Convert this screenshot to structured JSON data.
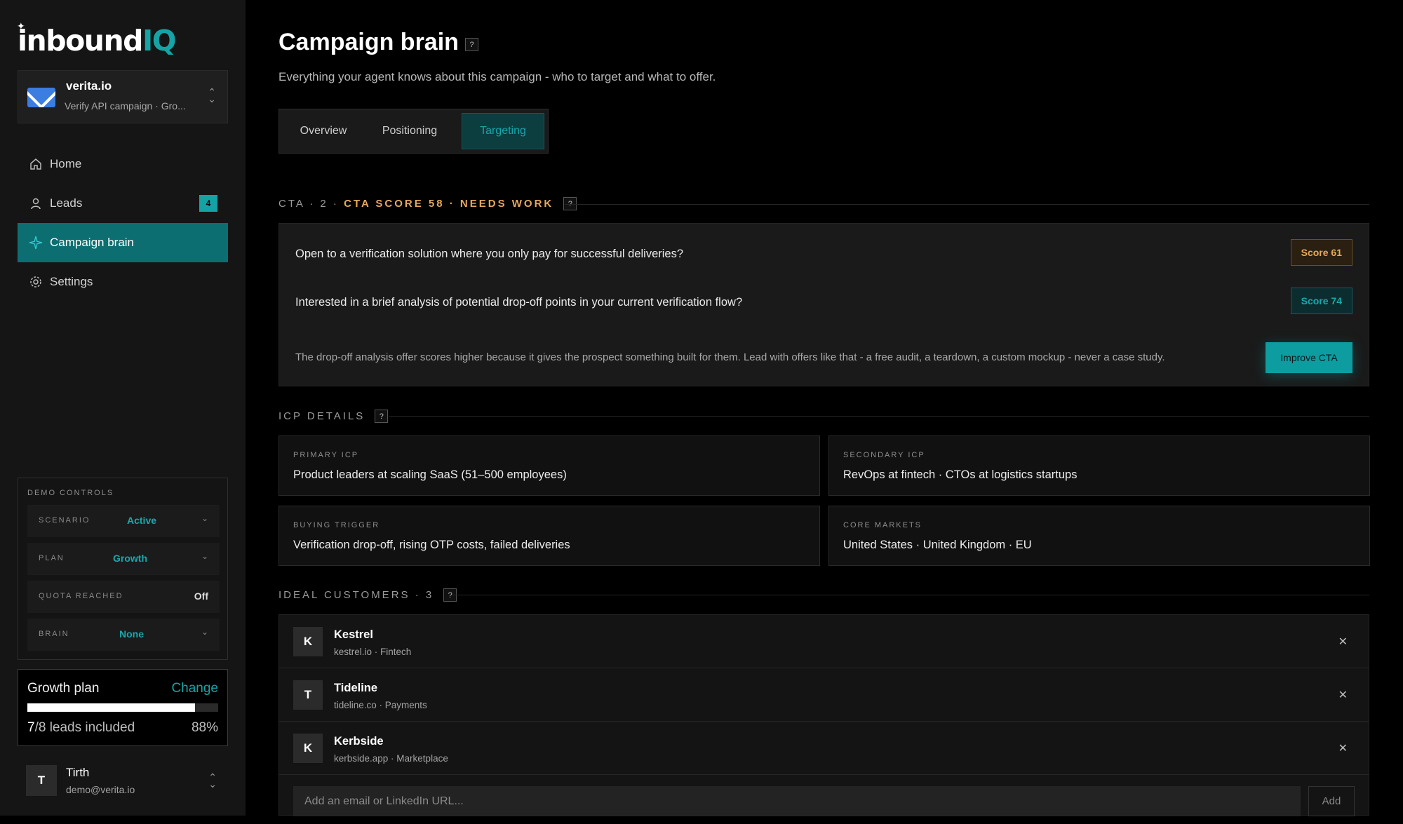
{
  "brand": {
    "logo_main": "inbound",
    "logo_accent": "IQ"
  },
  "workspace": {
    "name": "verita.io",
    "subtitle": "Verify API campaign · Gro..."
  },
  "nav": [
    {
      "label": "Home",
      "icon": "home-icon"
    },
    {
      "label": "Leads",
      "icon": "user-icon",
      "badge": "4"
    },
    {
      "label": "Campaign brain",
      "icon": "sparkle-icon",
      "active": true
    },
    {
      "label": "Settings",
      "icon": "gear-icon"
    }
  ],
  "demo_controls": {
    "title": "DEMO CONTROLS",
    "rows": [
      {
        "key": "SCENARIO",
        "value": "Active"
      },
      {
        "key": "PLAN",
        "value": "Growth"
      },
      {
        "key": "QUOTA REACHED",
        "value": "Off"
      },
      {
        "key": "BRAIN",
        "value": "None"
      }
    ]
  },
  "plan": {
    "title": "Growth plan",
    "change": "Change",
    "used": "7",
    "total": "/8 leads included",
    "percent": "88%",
    "fill_fraction": 0.88
  },
  "user": {
    "initial": "T",
    "name": "Tirth",
    "email": "demo@verita.io"
  },
  "page": {
    "title": "Campaign brain",
    "subtitle": "Everything your agent knows about this campaign - who to target and what to offer.",
    "tabs": [
      "Overview",
      "Positioning",
      "Targeting"
    ],
    "active_tab": "Targeting"
  },
  "cta": {
    "header_prefix": "CTA · 2 ·",
    "header_score": "CTA SCORE 58 · NEEDS WORK",
    "items": [
      {
        "question": "Open to a verification solution where you only pay for successful deliveries?",
        "score": "Score 61",
        "status": "warn"
      },
      {
        "question": "Interested in a brief analysis of potential drop-off points in your current verification flow?",
        "score": "Score 74",
        "status": "good"
      }
    ],
    "note": "The drop-off analysis offer scores higher because it gives the prospect something built for them. Lead with offers like that - a free audit, a teardown, a custom mockup - never a case study.",
    "improve_label": "Improve CTA"
  },
  "icp": {
    "header": "ICP DETAILS",
    "cards": [
      {
        "label": "PRIMARY ICP",
        "value": "Product leaders at scaling SaaS (51–500 employees)"
      },
      {
        "label": "SECONDARY ICP",
        "value": "RevOps at fintech · CTOs at logistics startups"
      },
      {
        "label": "BUYING TRIGGER",
        "value": "Verification drop-off, rising OTP costs, failed deliveries"
      },
      {
        "label": "CORE MARKETS",
        "value": "United States · United Kingdom · EU"
      }
    ]
  },
  "customers": {
    "header": "IDEAL CUSTOMERS · 3",
    "items": [
      {
        "initial": "K",
        "name": "Kestrel",
        "meta": "kestrel.io · Fintech"
      },
      {
        "initial": "T",
        "name": "Tideline",
        "meta": "tideline.co · Payments"
      },
      {
        "initial": "K",
        "name": "Kerbside",
        "meta": "kerbside.app · Marketplace"
      }
    ],
    "input_placeholder": "Add an email or LinkedIn URL...",
    "add_label": "Add"
  },
  "colors": {
    "accent": "#16a3a6",
    "warn": "#e8a85c",
    "background": "#000000",
    "sidebar": "#151515"
  }
}
